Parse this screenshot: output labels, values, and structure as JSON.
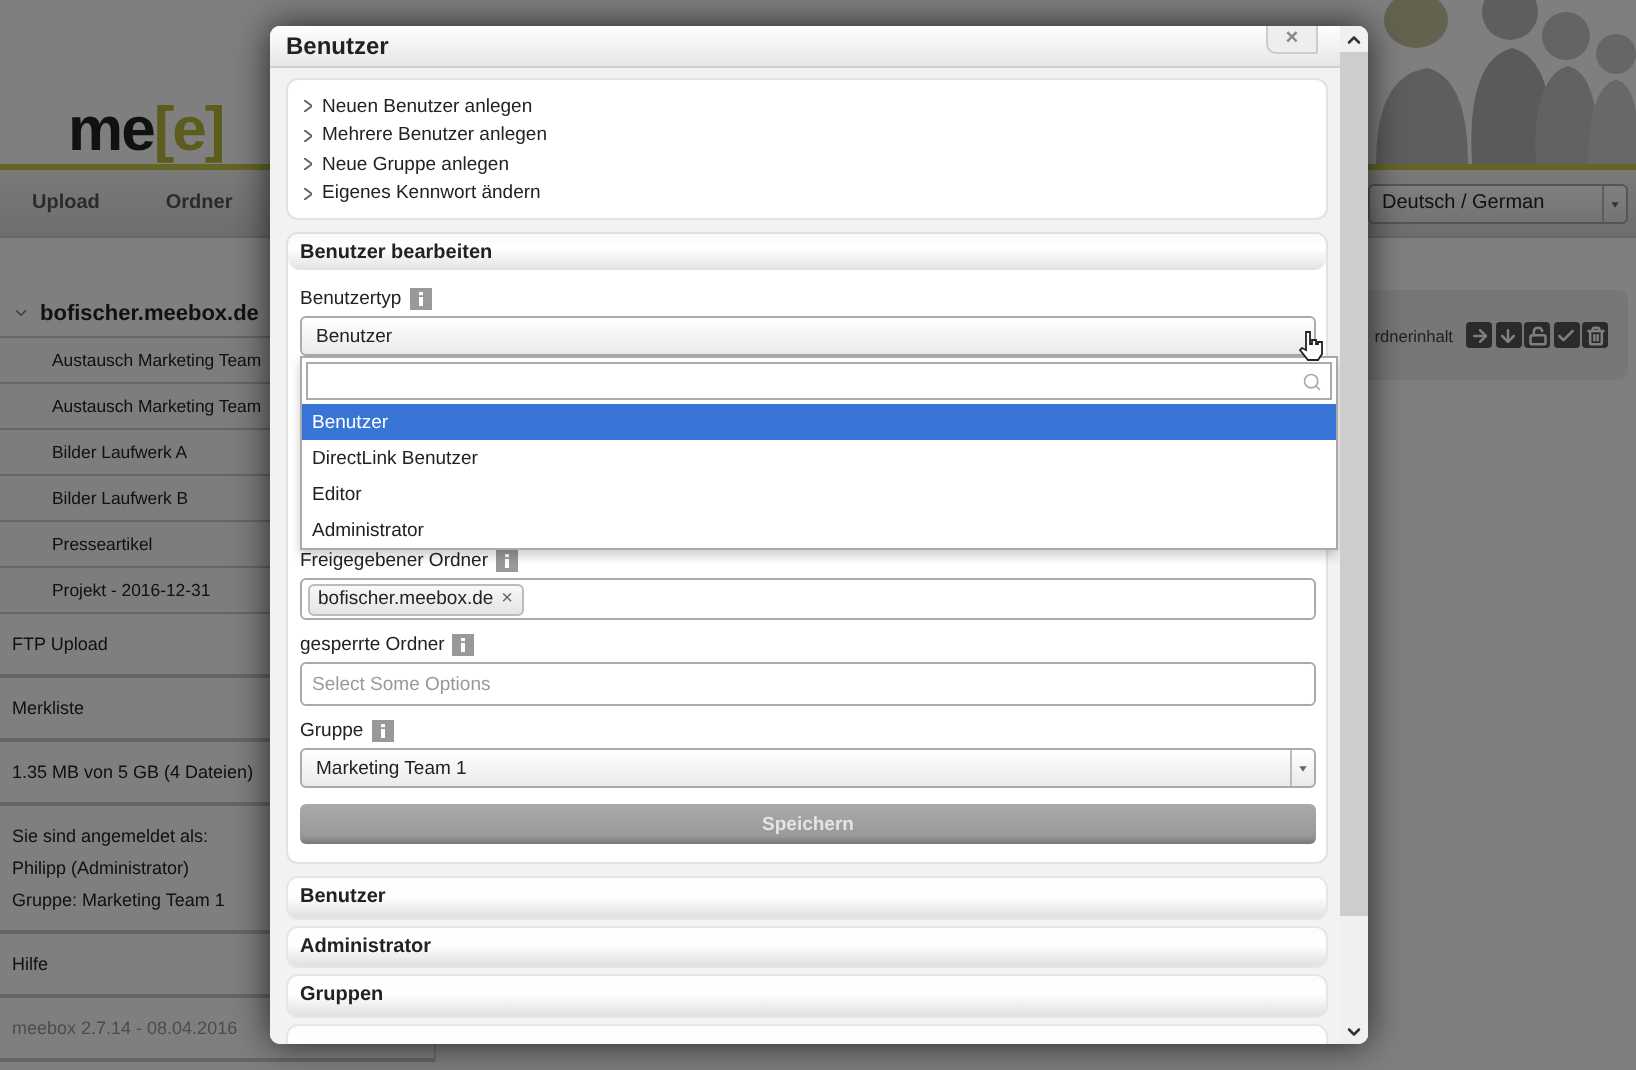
{
  "header": {
    "logo": [
      {
        "text": "me",
        "accent": false
      },
      {
        "text": "[e]",
        "accent": true
      }
    ]
  },
  "nav": {
    "items": [
      "Upload",
      "Ordner"
    ],
    "language": "Deutsch / German"
  },
  "sidebar": {
    "tree": {
      "label": "bofischer.meebox.de",
      "expanded": true,
      "children": [
        {
          "label": "Austausch Marketing Team"
        },
        {
          "label": "Austausch Marketing Team"
        },
        {
          "label": "Bilder Laufwerk A"
        },
        {
          "label": "Bilder Laufwerk B"
        },
        {
          "label": "Presseartikel"
        },
        {
          "label": "Projekt - 2016-12-31"
        }
      ]
    },
    "links": [
      "FTP Upload",
      "Merkliste"
    ],
    "storage": "1.35 MB von 5 GB (4 Dateien)",
    "login": [
      "Sie sind angemeldet als:",
      "Philipp (Administrator)",
      "Gruppe: Marketing Team 1"
    ],
    "help": "Hilfe",
    "version": "meebox 2.7.14 - 08.04.2016"
  },
  "toolbar": {
    "label": "rdnerinhalt"
  },
  "dialog": {
    "title": "Benutzer",
    "close": "×",
    "links": [
      "Neuen Benutzer anlegen",
      "Mehrere Benutzer anlegen",
      "Neue Gruppe anlegen",
      "Eigenes Kennwort ändern"
    ],
    "edit_section": {
      "title": "Benutzer bearbeiten",
      "user_type": {
        "label": "Benutzertyp",
        "value": "Benutzer",
        "open": true,
        "options": [
          {
            "label": "Benutzer",
            "selected": true
          },
          {
            "label": "DirectLink Benutzer",
            "selected": false
          },
          {
            "label": "Editor",
            "selected": false
          },
          {
            "label": "Administrator",
            "selected": false
          }
        ]
      },
      "shared_folders": {
        "label": "Freigegebener Ordner",
        "tags": [
          "bofischer.meebox.de"
        ],
        "remove": "×"
      },
      "locked_folders": {
        "label": "gesperrte Ordner",
        "placeholder": "Select Some Options"
      },
      "group": {
        "label": "Gruppe",
        "value": "Marketing Team 1"
      },
      "save": {
        "label": "Speichern",
        "disabled": true
      }
    },
    "sections": [
      "Benutzer",
      "Administrator",
      "Gruppen"
    ]
  }
}
